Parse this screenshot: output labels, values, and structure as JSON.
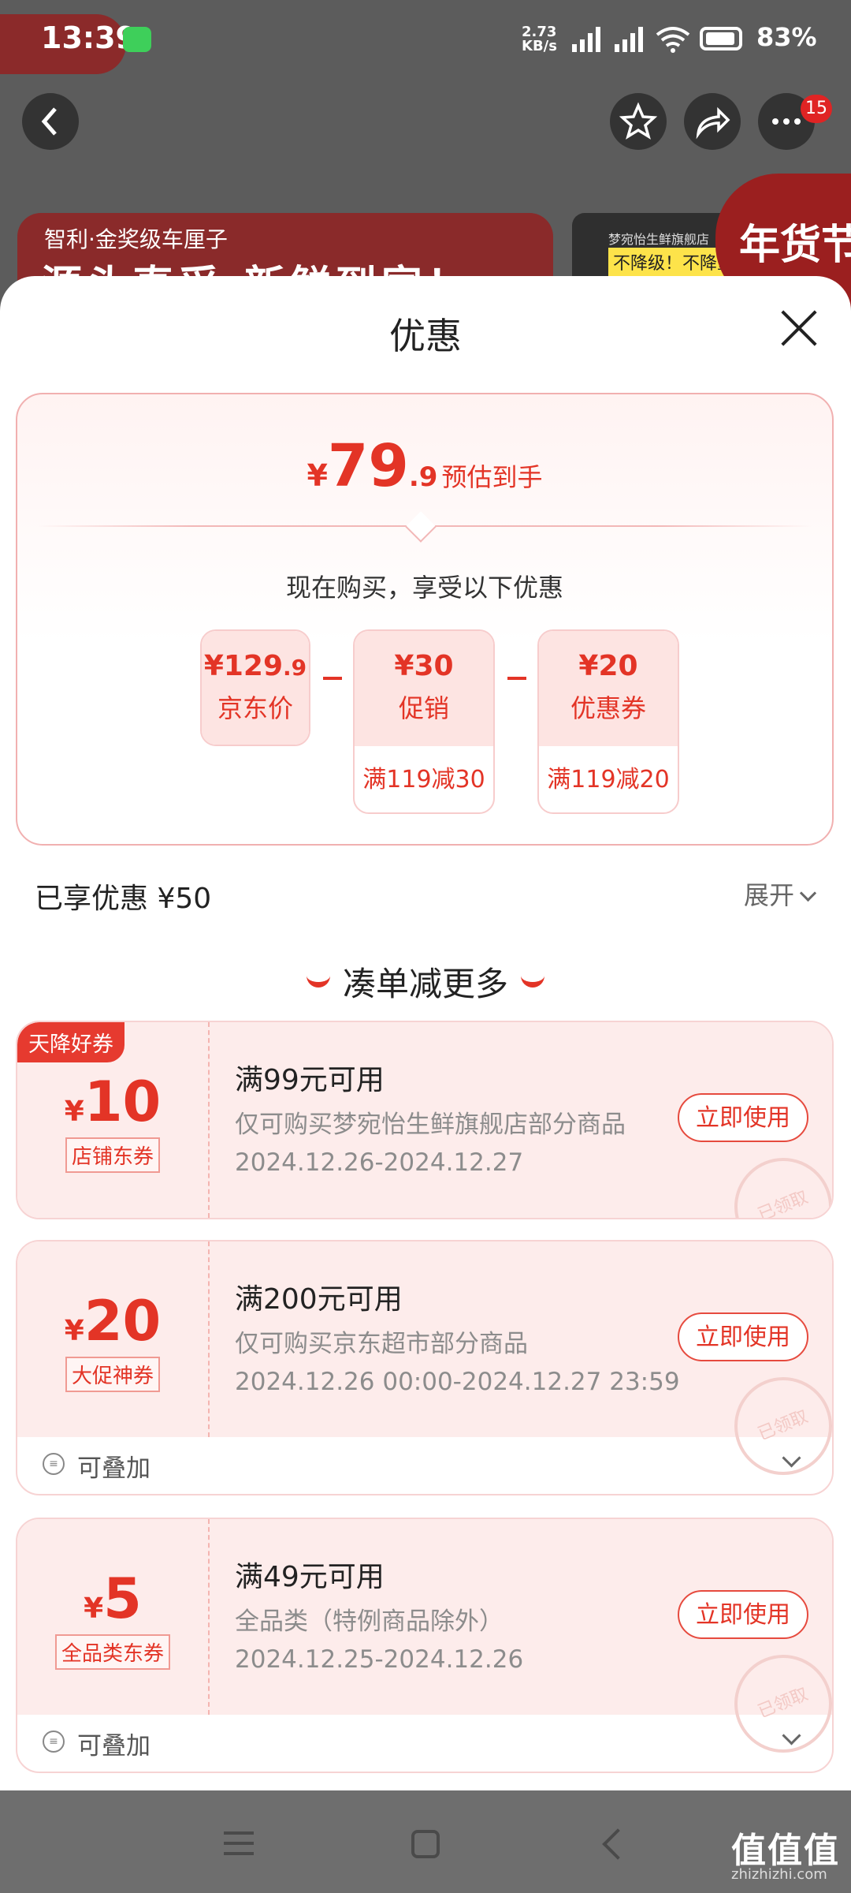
{
  "status_bar": {
    "time": "13:39",
    "net_speed": "2.73 KB/s",
    "battery": "83%"
  },
  "banner": {
    "subtitle": "智利·金奖级车厘子",
    "headline": "源头直采·新鲜到家！",
    "store_small": "梦宛怡生鲜旗舰店",
    "store_tag": "不降级！不降重！",
    "festival": "年货节"
  },
  "header": {
    "badge_count": "15"
  },
  "sheet": {
    "title": "优惠",
    "summary": {
      "currency": "¥",
      "price_int": "79",
      "price_dec": ".9",
      "price_label": "预估到手",
      "buy_now_text": "现在购买，享受以下优惠",
      "breakdown": [
        {
          "amount": "¥129",
          "decimal": ".9",
          "label": "京东价",
          "rule": ""
        },
        {
          "amount": "¥30",
          "decimal": "",
          "label": "促销",
          "rule": "满119减30"
        },
        {
          "amount": "¥20",
          "decimal": "",
          "label": "优惠券",
          "rule": "满119减20"
        }
      ]
    },
    "enjoyed": "已享优惠 ¥50",
    "expand_label": "展开",
    "more_title": "凑单减更多",
    "coupons": [
      {
        "ribbon": "天降好券",
        "currency": "¥",
        "amount": "10",
        "tag": "店铺东券",
        "title": "满99元可用",
        "scope": "仅可购买梦宛怡生鲜旗舰店部分商品",
        "date": "2024.12.26-2024.12.27",
        "button": "立即使用",
        "stamp": "已领取",
        "stackable": ""
      },
      {
        "ribbon": "",
        "currency": "¥",
        "amount": "20",
        "tag": "大促神券",
        "title": "满200元可用",
        "scope": "仅可购买京东超市部分商品",
        "date": "2024.12.26 00:00-2024.12.27 23:59",
        "button": "立即使用",
        "stamp": "已领取",
        "stackable": "可叠加"
      },
      {
        "ribbon": "",
        "currency": "¥",
        "amount": "5",
        "tag": "全品类东券",
        "title": "满49元可用",
        "scope": "全品类（特例商品除外）",
        "date": "2024.12.25-2024.12.26",
        "button": "立即使用",
        "stamp": "已领取",
        "stackable": "可叠加"
      }
    ]
  },
  "watermark": {
    "brand": "值值值",
    "url": "zhizhizhi.com"
  },
  "colors": {
    "accent": "#e33426",
    "pink_bg": "#fdeceb",
    "backdrop": "#6e6e6e"
  },
  "icons": [
    "back-icon",
    "star-icon",
    "share-icon",
    "more-icon",
    "close-icon",
    "chevron-down-icon",
    "stack-icon",
    "wifi-icon",
    "signal-icon",
    "battery-icon",
    "wechat-icon"
  ]
}
